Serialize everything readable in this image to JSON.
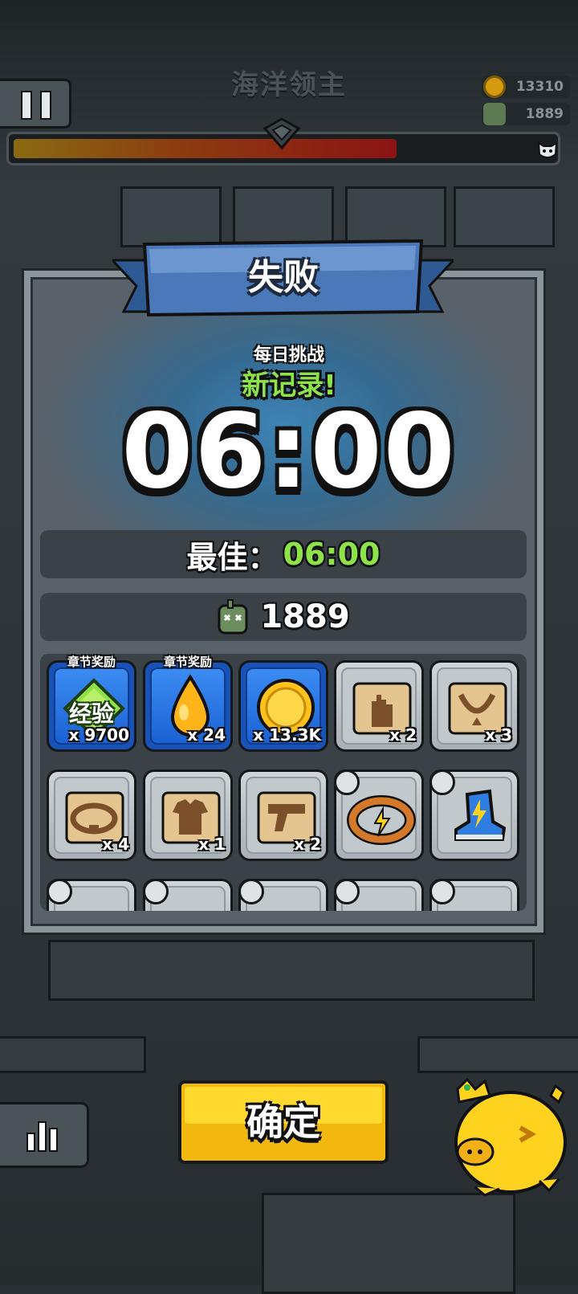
{
  "header": {
    "boss_name": "海洋领主",
    "coins": "13310",
    "kills": "1889",
    "boss_hp_percent": 71
  },
  "result": {
    "title": "失败",
    "mode": "每日挑战",
    "new_record": "新记录!",
    "time": "06:00",
    "best_label": "最佳：",
    "best_value": "06:00",
    "kill_count": "1889"
  },
  "rewards": [
    {
      "type": "exp",
      "tag": "章节奖励",
      "label": "经验",
      "count": "x 9700",
      "style": "blue"
    },
    {
      "type": "essence-drop",
      "tag": "章节奖励",
      "count": "x 24",
      "style": "blue"
    },
    {
      "type": "gold-coin",
      "count": "x 13.3K",
      "style": "blue"
    },
    {
      "type": "glove-scroll",
      "count": "x 2",
      "style": "gray"
    },
    {
      "type": "necklace-scroll",
      "count": "x 3",
      "style": "gray"
    },
    {
      "type": "belt-scroll",
      "count": "x 4",
      "style": "gray"
    },
    {
      "type": "armor-scroll",
      "count": "x 1",
      "style": "gray"
    },
    {
      "type": "weapon-scroll",
      "count": "x 2",
      "style": "gray"
    },
    {
      "type": "lightning-belt",
      "style": "gray"
    },
    {
      "type": "blue-boots",
      "style": "gray"
    }
  ],
  "buttons": {
    "confirm": "确定"
  },
  "colors": {
    "accent_green": "#8ee34a",
    "confirm_yellow": "#f2b80f",
    "ribbon_blue": "#4a78b8",
    "reward_blue": "#1b62d4"
  }
}
